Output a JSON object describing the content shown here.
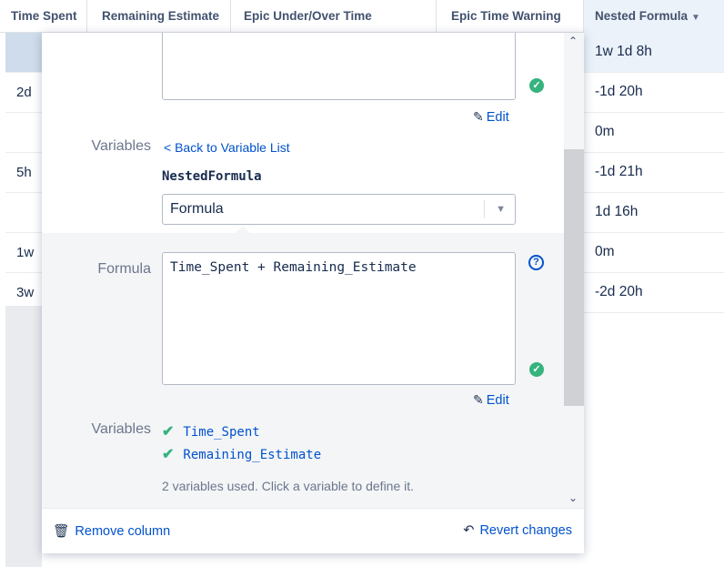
{
  "grid": {
    "headers": [
      "Time Spent",
      "Remaining Estimate",
      "Epic Under/Over Time",
      "Epic Time Warning",
      "Nested Formula"
    ],
    "left_values": [
      "",
      "2d",
      "",
      "5h",
      "",
      "1w",
      "3w"
    ],
    "nested_values": [
      "1w 1d 8h",
      "-1d 20h",
      "0m",
      "-1d 21h",
      "1d 16h",
      "0m",
      "-2d 20h"
    ]
  },
  "popup": {
    "edit_label": "Edit",
    "variables_label": "Variables",
    "back_link": "< Back to Variable List",
    "variable_name": "NestedFormula",
    "variable_type": "Formula",
    "formula_label": "Formula",
    "formula_text": "Time_Spent + Remaining_Estimate",
    "formula_edit_label": "Edit",
    "formula_variables_label": "Variables",
    "variables": [
      "Time_Spent",
      "Remaining_Estimate"
    ],
    "hint": "2 variables used. Click a variable to define it.",
    "remove_column": "Remove column",
    "revert_changes": "Revert changes"
  },
  "colors": {
    "link": "#0052cc",
    "success": "#36b37e",
    "selected_row": "#ebf2f9"
  },
  "icons": {
    "check": "check-circle-icon",
    "pencil": "pencil-icon",
    "help": "question-circle-icon",
    "trash": "trash-icon",
    "revert": "revert-icon",
    "sort": "sort-desc-icon"
  }
}
